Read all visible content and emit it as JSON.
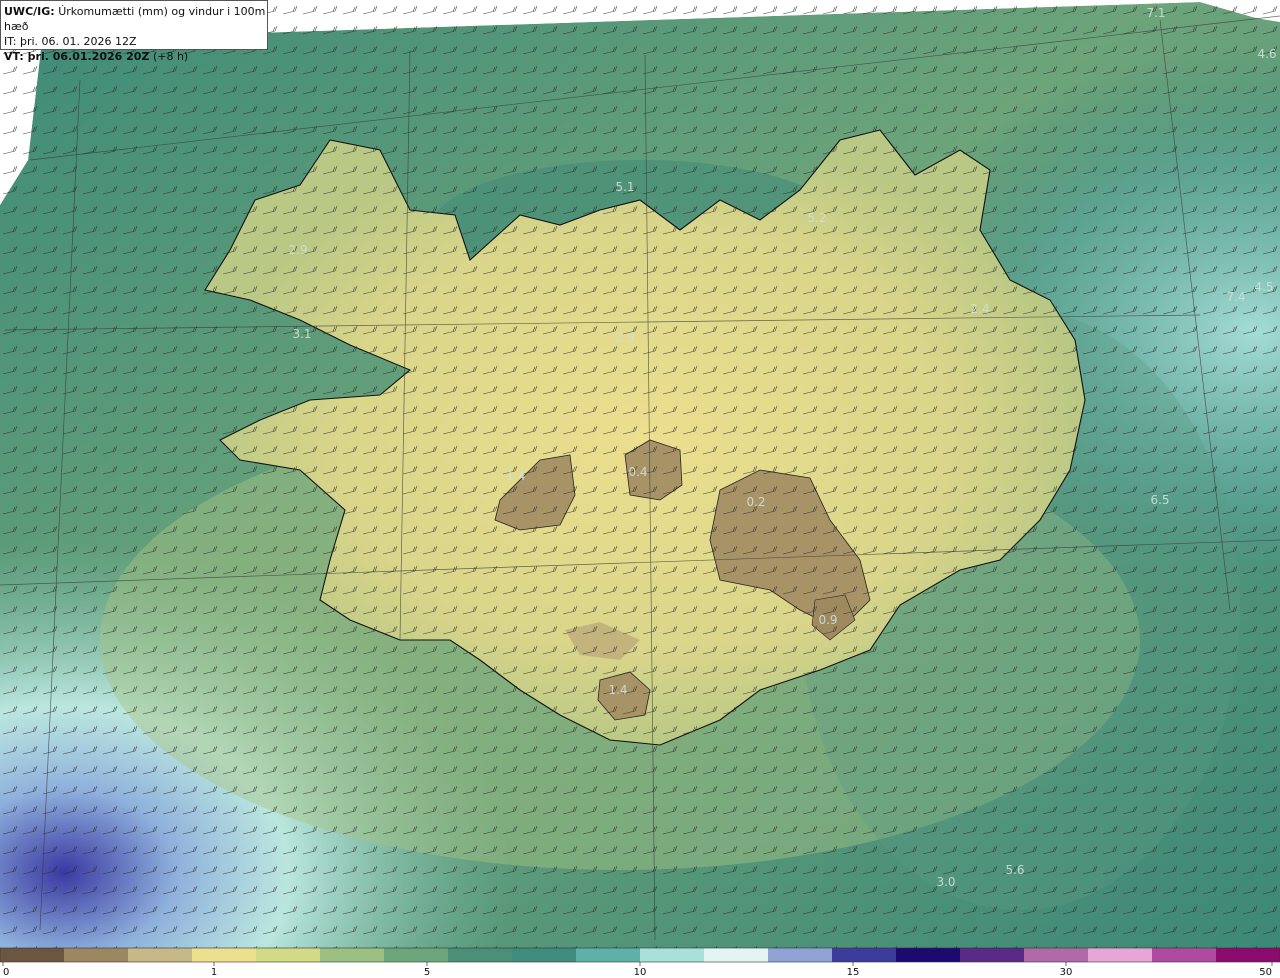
{
  "header": {
    "model_prefix": "UWC/IG:",
    "title_rest": "Úrkomumætti (mm) og vindur i 100m hæð",
    "it_line": "IT: þri. 06. 01. 2026 12Z",
    "vt_bold": "VT: þri. 06.01.2026 20Z",
    "vt_offset": "(+8 h)"
  },
  "value_labels": [
    "7.1",
    "4.6",
    "5.1",
    "5.2",
    "2.9",
    "3.1",
    "2.9",
    "2.4",
    "7.4",
    "4.5",
    "1.4",
    "0.4",
    "0.2",
    "6.5",
    "0.9",
    "1.4",
    "3.0",
    "5.6"
  ],
  "colorbar": {
    "ticks": [
      "0",
      "1",
      "5",
      "10",
      "15",
      "30",
      "50"
    ],
    "colors": [
      "#6b5640",
      "#9c8860",
      "#c7b987",
      "#ece08e",
      "#d2da88",
      "#9cc082",
      "#6ea67c",
      "#4c8f78",
      "#3f8c7e",
      "#5fb0a8",
      "#a8e0da",
      "#e2f5f4",
      "#8fa3d4",
      "#3c3c9c",
      "#1d0a6e",
      "#5a2a86",
      "#b06aa8",
      "#e8a6d8",
      "#b04aa0",
      "#8a0a6e"
    ]
  },
  "colors": {
    "ocean_dark": "#2f7a6c",
    "ocean_mid": "#4e9272",
    "land_low": "#c9c97d",
    "land_dry": "#e8df8c",
    "ice_cap": "#a28f66",
    "light_cyan": "#c2ecea"
  }
}
